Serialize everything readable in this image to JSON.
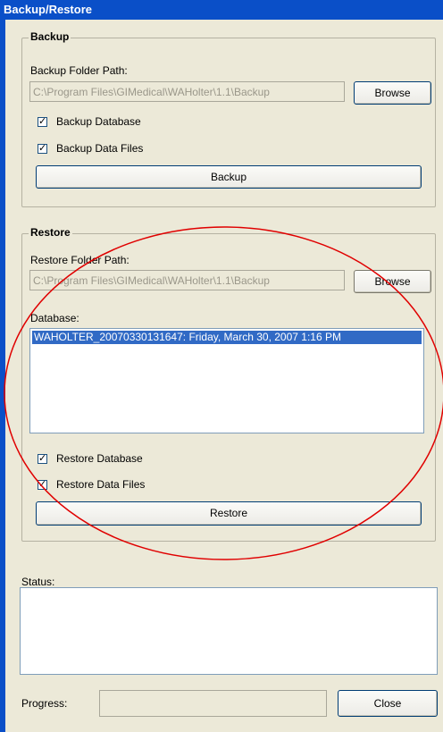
{
  "window": {
    "title": "Backup/Restore"
  },
  "backup": {
    "legend": "Backup",
    "folder_label": "Backup Folder Path:",
    "folder_value": "C:\\Program Files\\GIMedical\\WAHolter\\1.1\\Backup",
    "browse_label": "Browse",
    "db_checkbox": {
      "label": "Backup Database",
      "checked": true
    },
    "files_checkbox": {
      "label": "Backup Data Files",
      "checked": true
    },
    "action_label": "Backup"
  },
  "restore": {
    "legend": "Restore",
    "folder_label": "Restore Folder Path:",
    "folder_value": "C:\\Program Files\\GIMedical\\WAHolter\\1.1\\Backup",
    "browse_label": "Browse",
    "database_label": "Database:",
    "database_items": [
      "WAHOLTER_20070330131647: Friday, March 30, 2007 1:16 PM"
    ],
    "db_checkbox": {
      "label": "Restore Database",
      "checked": true
    },
    "files_checkbox": {
      "label": "Restore Data Files",
      "checked": true
    },
    "action_label": "Restore"
  },
  "status": {
    "label": "Status:",
    "text": ""
  },
  "progress": {
    "label": "Progress:",
    "value": 0
  },
  "close_label": "Close",
  "colors": {
    "title_bar": "#0a4fc8",
    "selection": "#316ac5",
    "annotation": "#e00000"
  },
  "icons": {
    "checkmark": "check-icon"
  }
}
